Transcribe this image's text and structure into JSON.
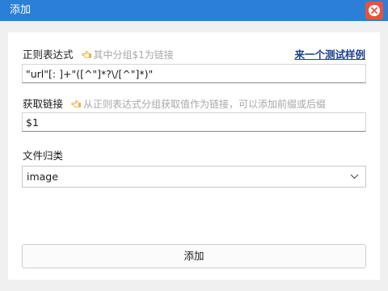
{
  "window": {
    "title": "添加",
    "accent_color": "#2b7fd6",
    "close_color": "#e8533b",
    "close_icon": "close-circle-icon"
  },
  "regex": {
    "label": "正则表达式",
    "hint_icon": "pointing-hand-icon",
    "hint": "其中分组$1为链接",
    "sample_link": "来一个测试样例",
    "value": "\"url\"[: ]+\"([^\"]*?\\/[^\"]*)\""
  },
  "link": {
    "label": "获取链接",
    "hint_icon": "pointing-hand-icon",
    "hint": "从正则表达式分组获取值作为链接，可以添加前缀或后缀",
    "value": "$1"
  },
  "category": {
    "label": "文件归类",
    "selected": "image",
    "dropdown_icon": "chevron-down-icon"
  },
  "submit": {
    "label": "添加"
  }
}
